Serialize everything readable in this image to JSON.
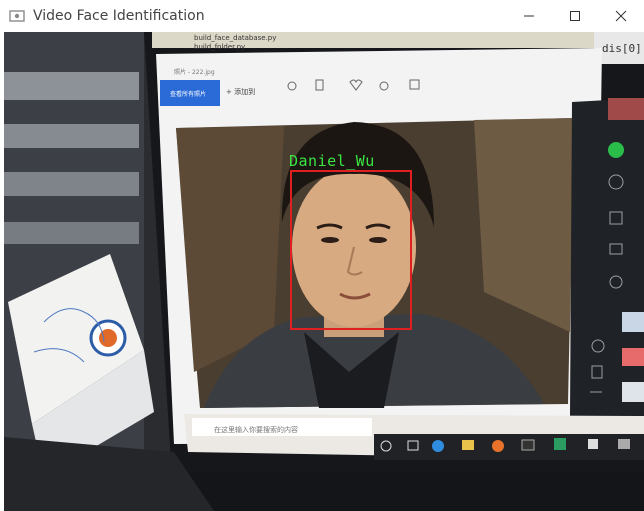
{
  "window": {
    "title": "Video Face Identification",
    "controls": {
      "minimize": "minimize-icon",
      "maximize": "maximize-icon",
      "close": "close-icon"
    }
  },
  "detection": {
    "label": "Daniel_Wu",
    "box_color": "#e02020",
    "label_color": "#39e642"
  },
  "scene": {
    "code_tab_1": "build_face_database.py",
    "code_tab_2": "build_folder.py",
    "code_fragment": "dis[0]",
    "viewer_title": "照片 - 222.jpg",
    "viewer_button": "查看所有照片",
    "viewer_add": "+ 添加到",
    "taskbar_search": "在这里输入你要搜索的内容"
  }
}
